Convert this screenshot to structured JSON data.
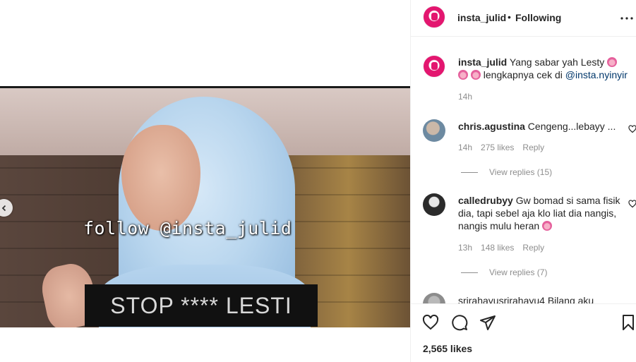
{
  "media": {
    "watermark": "follow @insta_julid",
    "caption_box": "STOP **** LESTI"
  },
  "header": {
    "username": "insta_julid",
    "dot": "•",
    "follow_label": "Following"
  },
  "post": {
    "username": "insta_julid",
    "caption_part1": " Yang sabar yah Lesty",
    "caption_part2": " lengkapnya cek di ",
    "mention": "@insta.nyinyir",
    "time": "14h"
  },
  "comments": [
    {
      "username": "chris.agustina",
      "text": " Cengeng...lebayy ...",
      "time": "14h",
      "likes": "275 likes",
      "reply": "Reply",
      "view_replies": "View replies (15)"
    },
    {
      "username": "calledrubyy",
      "text_line1": " Gw bomad si sama fisik",
      "text_line2": "dia, tapi sebel aja klo liat dia nangis,",
      "text_line3": "nangis mulu heran",
      "time": "13h",
      "likes": "148 likes",
      "reply": "Reply",
      "view_replies": "View replies (7)"
    },
    {
      "partial": "srirahayusrirahayu4 Bilang aku"
    }
  ],
  "likes_count": "2,565 likes",
  "colors": {
    "accent": "#e3166f",
    "link": "#00376b",
    "muted": "#8e8e8e"
  }
}
